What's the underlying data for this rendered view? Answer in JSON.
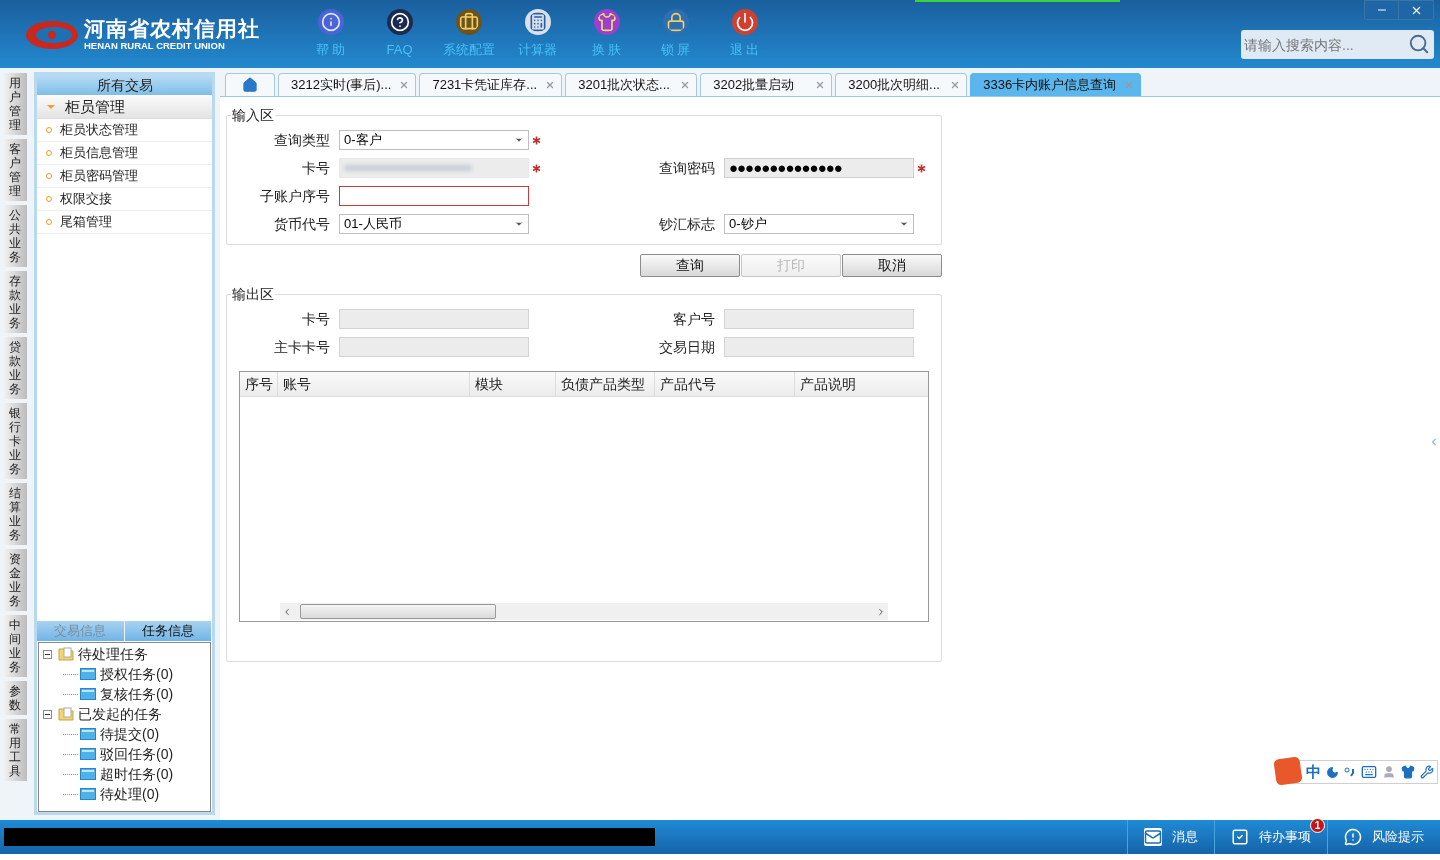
{
  "header": {
    "logo_cn": "河南省农村信用社",
    "logo_en": "HENAN RURAL CREDIT UNION",
    "toolbar": [
      {
        "kind": "info",
        "label": "帮 助"
      },
      {
        "kind": "faq",
        "label": "FAQ"
      },
      {
        "kind": "config",
        "label": "系统配置"
      },
      {
        "kind": "calculator",
        "label": "计算器"
      },
      {
        "kind": "skin",
        "label": "换 肤"
      },
      {
        "kind": "lock",
        "label": "锁 屏"
      },
      {
        "kind": "exit",
        "label": "退 出"
      }
    ],
    "search": {
      "placeholder": "请输入搜索内容..."
    }
  },
  "side_tabs": [
    "用户管理",
    "客户管理",
    "公共业务",
    "存款业务",
    "贷款业务",
    "银行卡业务",
    "结算业务",
    "资金业务",
    "中间业务",
    "参数",
    "常用工具"
  ],
  "sidebar": {
    "title": "所有交易",
    "group": {
      "label": "柜员管理",
      "expanded": true,
      "items": [
        "柜员状态管理",
        "柜员信息管理",
        "柜员密码管理",
        "权限交接",
        "尾箱管理"
      ]
    },
    "bottom_tabs": [
      {
        "label": "交易信息",
        "selected": false
      },
      {
        "label": "任务信息",
        "selected": true
      }
    ],
    "tree": [
      {
        "label": "待处理任务",
        "expanded": true,
        "children": [
          {
            "label": "授权任务(0)"
          },
          {
            "label": "复核任务(0)"
          }
        ]
      },
      {
        "label": "已发起的任务",
        "expanded": true,
        "children": [
          {
            "label": "待提交(0)"
          },
          {
            "label": "驳回任务(0)"
          },
          {
            "label": "超时任务(0)"
          },
          {
            "label": "待处理(0)"
          }
        ]
      }
    ]
  },
  "tabs": [
    {
      "kind": "home",
      "selected": false
    },
    {
      "label": "3212实时(事后)...",
      "selected": false
    },
    {
      "label": "7231卡凭证库存...",
      "selected": false
    },
    {
      "label": "3201批次状态...",
      "selected": false
    },
    {
      "label": "3202批量启动",
      "selected": false
    },
    {
      "label": "3200批次明细...",
      "selected": false
    },
    {
      "label": "3336卡内账户信息查询",
      "selected": true
    }
  ],
  "input_section": {
    "title": "输入区",
    "rows": [
      [
        {
          "label": "查询类型",
          "kind": "select",
          "value": "0-客户",
          "required": true
        }
      ],
      [
        {
          "label": "卡号",
          "kind": "masked",
          "required": true
        },
        {
          "label": "查询密码",
          "kind": "password",
          "value": "●●●●●●●●●●●●●●",
          "required": true
        }
      ],
      [
        {
          "label": "子账户序号",
          "kind": "text",
          "required": false,
          "error": true
        }
      ],
      [
        {
          "label": "货币代号",
          "kind": "select",
          "value": "01-人民币",
          "required": false
        },
        {
          "label": "钞汇标志",
          "kind": "select",
          "value": "0-钞户",
          "required": false
        }
      ]
    ]
  },
  "buttons": [
    {
      "label": "查询",
      "disabled": false
    },
    {
      "label": "打印",
      "disabled": true
    },
    {
      "label": "取消",
      "disabled": false
    }
  ],
  "output_section": {
    "title": "输出区",
    "rows": [
      [
        {
          "label": "卡号",
          "kind": "readonly"
        },
        {
          "label": "客户号",
          "kind": "readonly"
        }
      ],
      [
        {
          "label": "主卡卡号",
          "kind": "readonly"
        },
        {
          "label": "交易日期",
          "kind": "readonly"
        }
      ]
    ],
    "table": {
      "columns": [
        "序号",
        "账号",
        "模块",
        "负债产品类型",
        "产品代号",
        "产品说明"
      ]
    }
  },
  "ime_bar": {
    "mode": "中"
  },
  "status_bar": [
    {
      "kind": "message",
      "label": "消息"
    },
    {
      "kind": "todo",
      "label": "待办事项",
      "badge": "1"
    },
    {
      "kind": "risk",
      "label": "风险提示"
    }
  ]
}
